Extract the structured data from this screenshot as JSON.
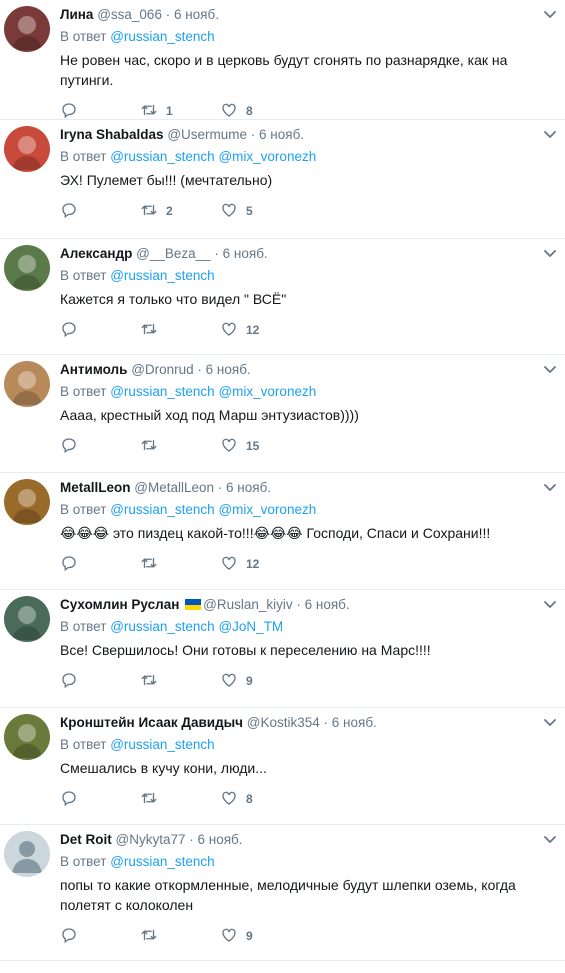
{
  "reply_prefix": "В ответ",
  "tweets": [
    {
      "name": "Лина",
      "handle": "@ssa_066",
      "time": "6 нояб.",
      "mentions": [
        "@russian_stench"
      ],
      "text": "Не ровен час, скоро и в церковь будут сгонять по разнарядке, как на путинги.",
      "retweets": "1",
      "likes": "8",
      "avatar_color": "#7a3a3a"
    },
    {
      "name": "Iryna Shabaldas",
      "handle": "@Usermume",
      "time": "6 нояб.",
      "mentions": [
        "@russian_stench",
        "@mix_voronezh"
      ],
      "text": "ЭХ! Пулемет бы!!! (мечтательно)",
      "retweets": "2",
      "likes": "5",
      "avatar_color": "#c84a3a"
    },
    {
      "name": "Александр",
      "handle": "@__Beza__",
      "time": "6 нояб.",
      "mentions": [
        "@russian_stench"
      ],
      "text": "Кажется я только что видел \" ВСЁ\"",
      "retweets": "",
      "likes": "12",
      "avatar_color": "#5b7a4a"
    },
    {
      "name": "Антимоль",
      "handle": "@Dronrud",
      "time": "6 нояб.",
      "mentions": [
        "@russian_stench",
        "@mix_voronezh"
      ],
      "text": "Аааа, крестный ход под Марш энтузиастов))))",
      "retweets": "",
      "likes": "15",
      "avatar_color": "#b88a5a"
    },
    {
      "name": "MetallLeon",
      "handle": "@MetallLeon",
      "time": "6 нояб.",
      "mentions": [
        "@russian_stench",
        "@mix_voronezh"
      ],
      "text": "😂😂😂 это пиздец какой-то!!!😂😂😂 Господи, Спаси и Сохрани!!!",
      "retweets": "",
      "likes": "12",
      "avatar_color": "#9a6a2a"
    },
    {
      "name": "Сухомлин Руслан",
      "handle": "@Ruslan_kiyiv",
      "time": "6 нояб.",
      "mentions": [
        "@russian_stench",
        "@JoN_TM"
      ],
      "text": "Все! Свершилось! Они готовы к переселению на Марс!!!!",
      "retweets": "",
      "likes": "9",
      "avatar_color": "#4a6a5a",
      "flag": true
    },
    {
      "name": "Кронштейн Исаак Давидыч",
      "handle": "@Kostik354",
      "time": "6 нояб.",
      "mentions": [
        "@russian_stench"
      ],
      "text": "Смешались в кучу кони, люди...",
      "retweets": "",
      "likes": "8",
      "avatar_color": "#6a7a3a"
    },
    {
      "name": "Det Roit",
      "handle": "@Nykyta77",
      "time": "6 нояб.",
      "mentions": [
        "@russian_stench"
      ],
      "text": "попы то какие откормленные, мелодичные будут шлепки оземь, когда полетят с колоколен",
      "retweets": "",
      "likes": "9",
      "avatar_color": "#ccd6dd",
      "default_avatar": true
    }
  ],
  "colors": {
    "link": "#1da1f2",
    "muted": "#657786",
    "flag_blue": "#0057b7",
    "flag_yellow": "#ffd700"
  },
  "icons": {
    "reply": "reply-icon",
    "retweet": "retweet-icon",
    "like": "heart-icon",
    "menu": "chevron-down-icon"
  }
}
